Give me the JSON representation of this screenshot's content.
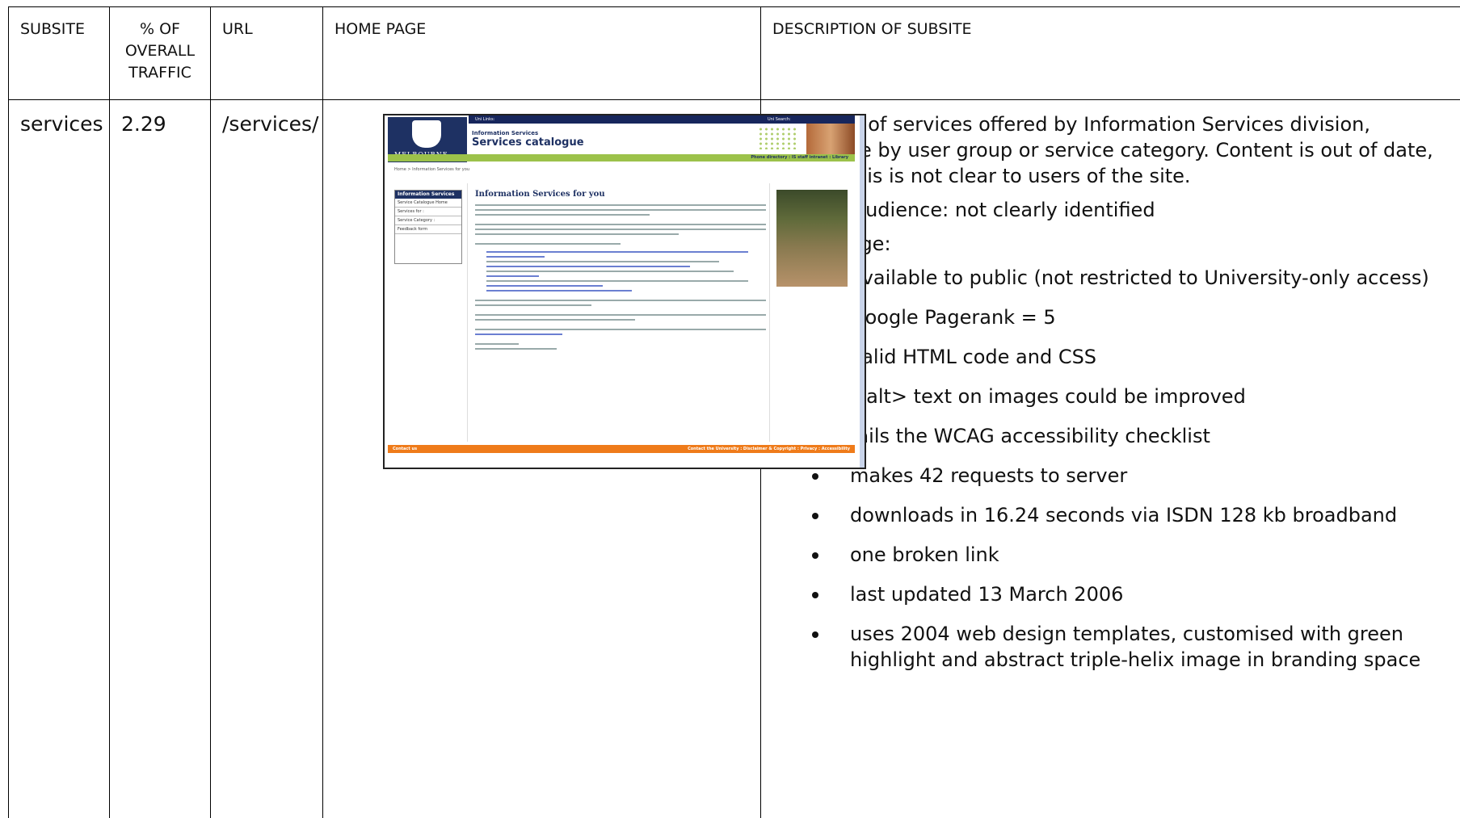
{
  "headers": {
    "subsite": "SUBSITE",
    "traffic": "% OF OVERALL TRAFFIC",
    "url": "URL",
    "home_page": "HOME PAGE",
    "description": "DESCRIPTION OF SUBSITE"
  },
  "row": {
    "subsite": "services",
    "traffic": "2.29",
    "url": "/services/",
    "description_paragraphs": [
      "Directory of services offered by Information Services division, browsable by user group or service category. Content is out of date, though this is not clear to users of the site.",
      "Primary audience: not clearly identified",
      "Home page:"
    ],
    "bullets": [
      "available to public (not restricted to University-only access)",
      "Google Pagerank = 5",
      "valid HTML code and CSS",
      "<alt> text on images could be improved",
      "fails the WCAG accessibility checklist",
      "makes 42 requests to server",
      "downloads in 16.24 seconds via ISDN 128 kb broadband",
      "one broken link",
      "last updated 13 March 2006",
      "uses 2004 web design templates, customised with green highlight and abstract triple-helix image in branding space"
    ]
  },
  "thumbnail": {
    "uni_links": "Uni Links:",
    "uni_search": "Uni Search:",
    "logo_text": "MELBOURNE",
    "section_small": "Information Services",
    "section_title": "Services catalogue",
    "utility_links": "Phone directory : IS staff intranet : Library",
    "breadcrumb": "Home > Information Services for you",
    "side_heading": "Information Services",
    "side_items": [
      "Service Catalogue Home",
      "Services for :",
      "Service Category :",
      "Feedback form"
    ],
    "heading": "Information Services for you",
    "footer_left": "Contact us",
    "footer_right": "Contact the University : Disclaimer & Copyright : Privacy : Accessibility",
    "colors": {
      "navy": "#1e3163",
      "green": "#9cc24a",
      "orange": "#ef7b1a"
    }
  }
}
